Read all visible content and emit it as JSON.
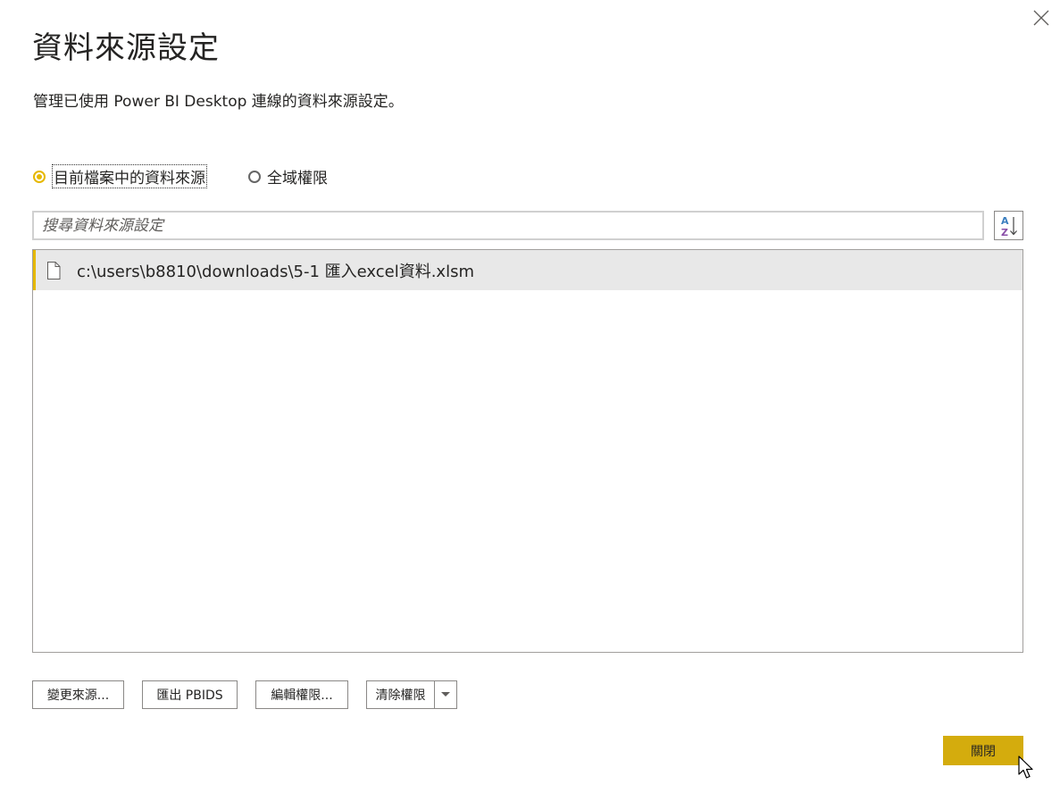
{
  "dialog": {
    "title": "資料來源設定",
    "subtitle": "管理已使用 Power BI Desktop 連線的資料來源設定。"
  },
  "scope": {
    "options": [
      {
        "label": "目前檔案中的資料來源",
        "selected": true
      },
      {
        "label": "全域權限",
        "selected": false
      }
    ]
  },
  "search": {
    "placeholder": "搜尋資料來源設定",
    "value": ""
  },
  "sort": {
    "icon": "sort-az-icon"
  },
  "sources": {
    "items": [
      {
        "label": "c:\\users\\b8810\\downloads\\5-1 匯入excel資料.xlsm",
        "icon": "file-icon"
      }
    ]
  },
  "actions": {
    "change_source": "變更來源...",
    "export_pbids": "匯出 PBIDS",
    "edit_permissions": "編輯權限...",
    "clear_permissions": "清除權限"
  },
  "footer": {
    "close_label": "關閉"
  },
  "colors": {
    "accent": "#e6b800",
    "primary_button": "#d4ac0d",
    "selected_row": "#e8e8e8"
  }
}
